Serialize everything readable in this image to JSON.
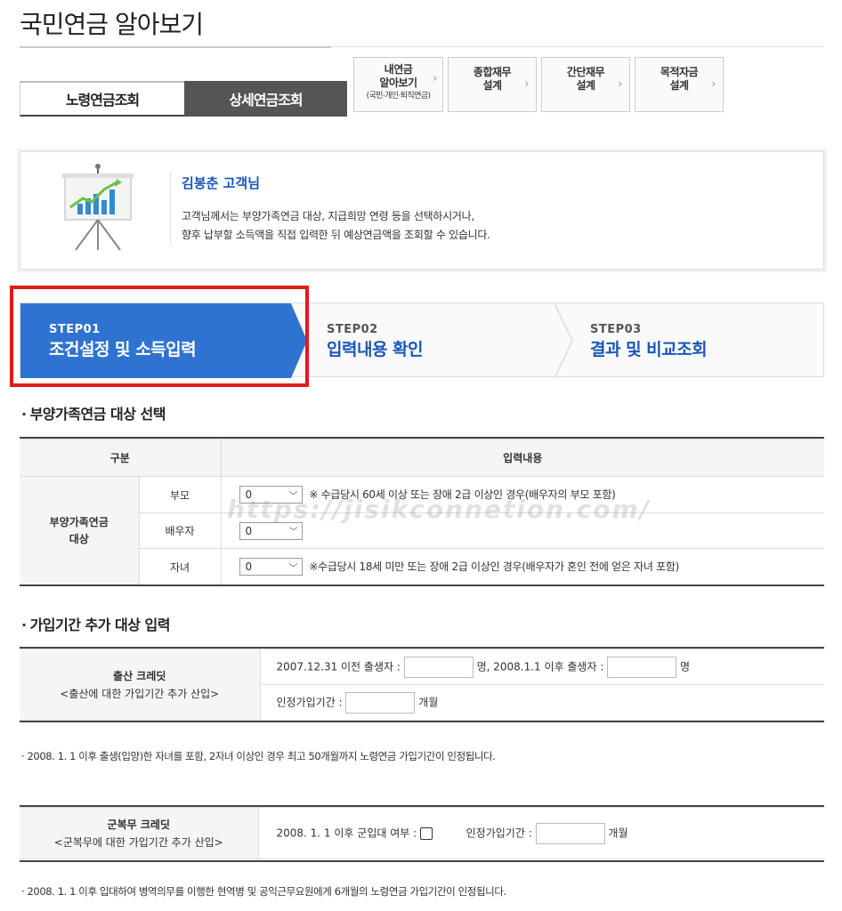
{
  "page": {
    "title": "국민연금 알아보기"
  },
  "tabs": {
    "basic": "노령연금조회",
    "detail": "상세연금조회"
  },
  "links": [
    {
      "line1": "내연금",
      "line2": "알아보기",
      "small": "(국민·개인·퇴직연금)"
    },
    {
      "line1": "종합재무",
      "line2": "설계"
    },
    {
      "line1": "간단재무",
      "line2": "설계"
    },
    {
      "line1": "목적자금",
      "line2": "설계"
    }
  ],
  "customer": {
    "name": "김봉춘 고객님",
    "desc1": "고객님께서는 부양가족연금 대상, 지급희망 연령 등을 선택하시거나,",
    "desc2": "향후 납부할 소득액을 직접 입력한 뒤 예상연금액을 조회할 수 있습니다.",
    "icon": "presentation-chart-icon"
  },
  "steps": [
    {
      "num": "STEP01",
      "label": "조건설정 및 소득입력",
      "active": true
    },
    {
      "num": "STEP02",
      "label": "입력내용 확인",
      "active": false
    },
    {
      "num": "STEP03",
      "label": "결과 및 비교조회",
      "active": false
    }
  ],
  "section1": {
    "title": "부양가족연금 대상 선택",
    "col1": "구분",
    "col2": "입력내용",
    "group": "부양가족연금 대상",
    "rows": [
      {
        "label": "부모",
        "value": "0",
        "note": "※ 수급당시 60세 이상 또는 장애 2급 이상인 경우(배우자의 부모 포함)"
      },
      {
        "label": "배우자",
        "value": "0",
        "note": ""
      },
      {
        "label": "자녀",
        "value": "0",
        "note": "※수급당시 18세 미만 또는 장애 2급 이상인 경우(배우자가 혼인 전에 얻은 자녀 포함)"
      }
    ]
  },
  "watermark": "https://jisikconnetion.com/",
  "section2": {
    "title": "가입기간 추가 대상 입력",
    "birth_title": "출산 크레딧",
    "birth_sub": "<출산에 대한 가입기간 추가 산입>",
    "birth_before": "2007.12.31 이전 출생자 :",
    "birth_mid": "명, 2008.1.1 이후 출생자 :",
    "birth_unit": "명",
    "birth_period_label": "인정가입기간 :",
    "birth_period_unit": "개월",
    "birth_note": "· 2008. 1. 1 이후 출생(입양)한 자녀를 포함, 2자녀 이상인 경우 최고 50개월까지 노령연금 가입기간이 인정됩니다.",
    "military_title": "군복무 크레딧",
    "military_sub": "<군복무에 대한 가입기간 추가 산입>",
    "military_enlist": "2008. 1. 1 이후 군입대 여부 :",
    "military_period_label": "인정가입기간 :",
    "military_period_unit": "개월",
    "military_note": "· 2008. 1. 1 이후 입대하여 병역의무를 이행한 현역병 및 공익근무요원에게 6개월의 노령연금 가입기간이 인정됩니다."
  },
  "colors": {
    "accent": "#2f73d0",
    "highlight": "#e11a1a",
    "link": "#1a56b8"
  }
}
